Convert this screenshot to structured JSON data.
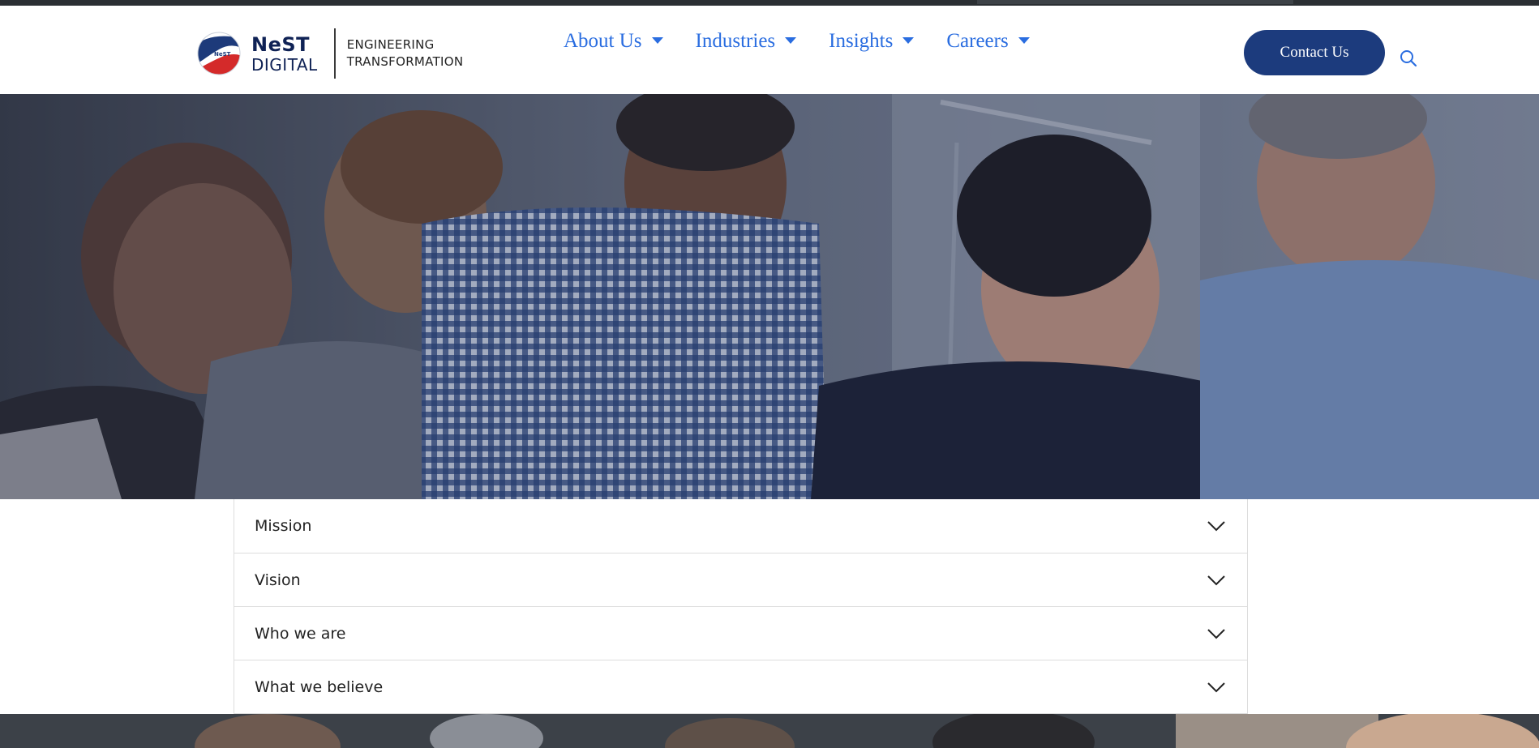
{
  "header": {
    "logo": {
      "name_line1": "NeST",
      "name_line2": "DIGITAL",
      "mark_text": "NeST",
      "tagline_line1": "ENGINEERING",
      "tagline_line2": "TRANSFORMATION"
    },
    "nav": [
      {
        "label": "About Us"
      },
      {
        "label": "Industries"
      },
      {
        "label": "Insights"
      },
      {
        "label": "Careers"
      }
    ],
    "contact_label": "Contact Us",
    "search_icon": "search-icon"
  },
  "hero": {
    "image": "team-collaborating-photo"
  },
  "accordion": [
    {
      "label": "Mission",
      "icon": "chevron-down-icon"
    },
    {
      "label": "Vision",
      "icon": "chevron-down-icon"
    },
    {
      "label": "Who we are",
      "icon": "chevron-down-icon"
    },
    {
      "label": "What we believe",
      "icon": "chevron-down-icon"
    }
  ],
  "colors": {
    "nav_link": "#2a6de0",
    "contact_button": "#1c3b7d",
    "brand_navy": "#0f2255",
    "brand_red": "#d42a2a"
  }
}
